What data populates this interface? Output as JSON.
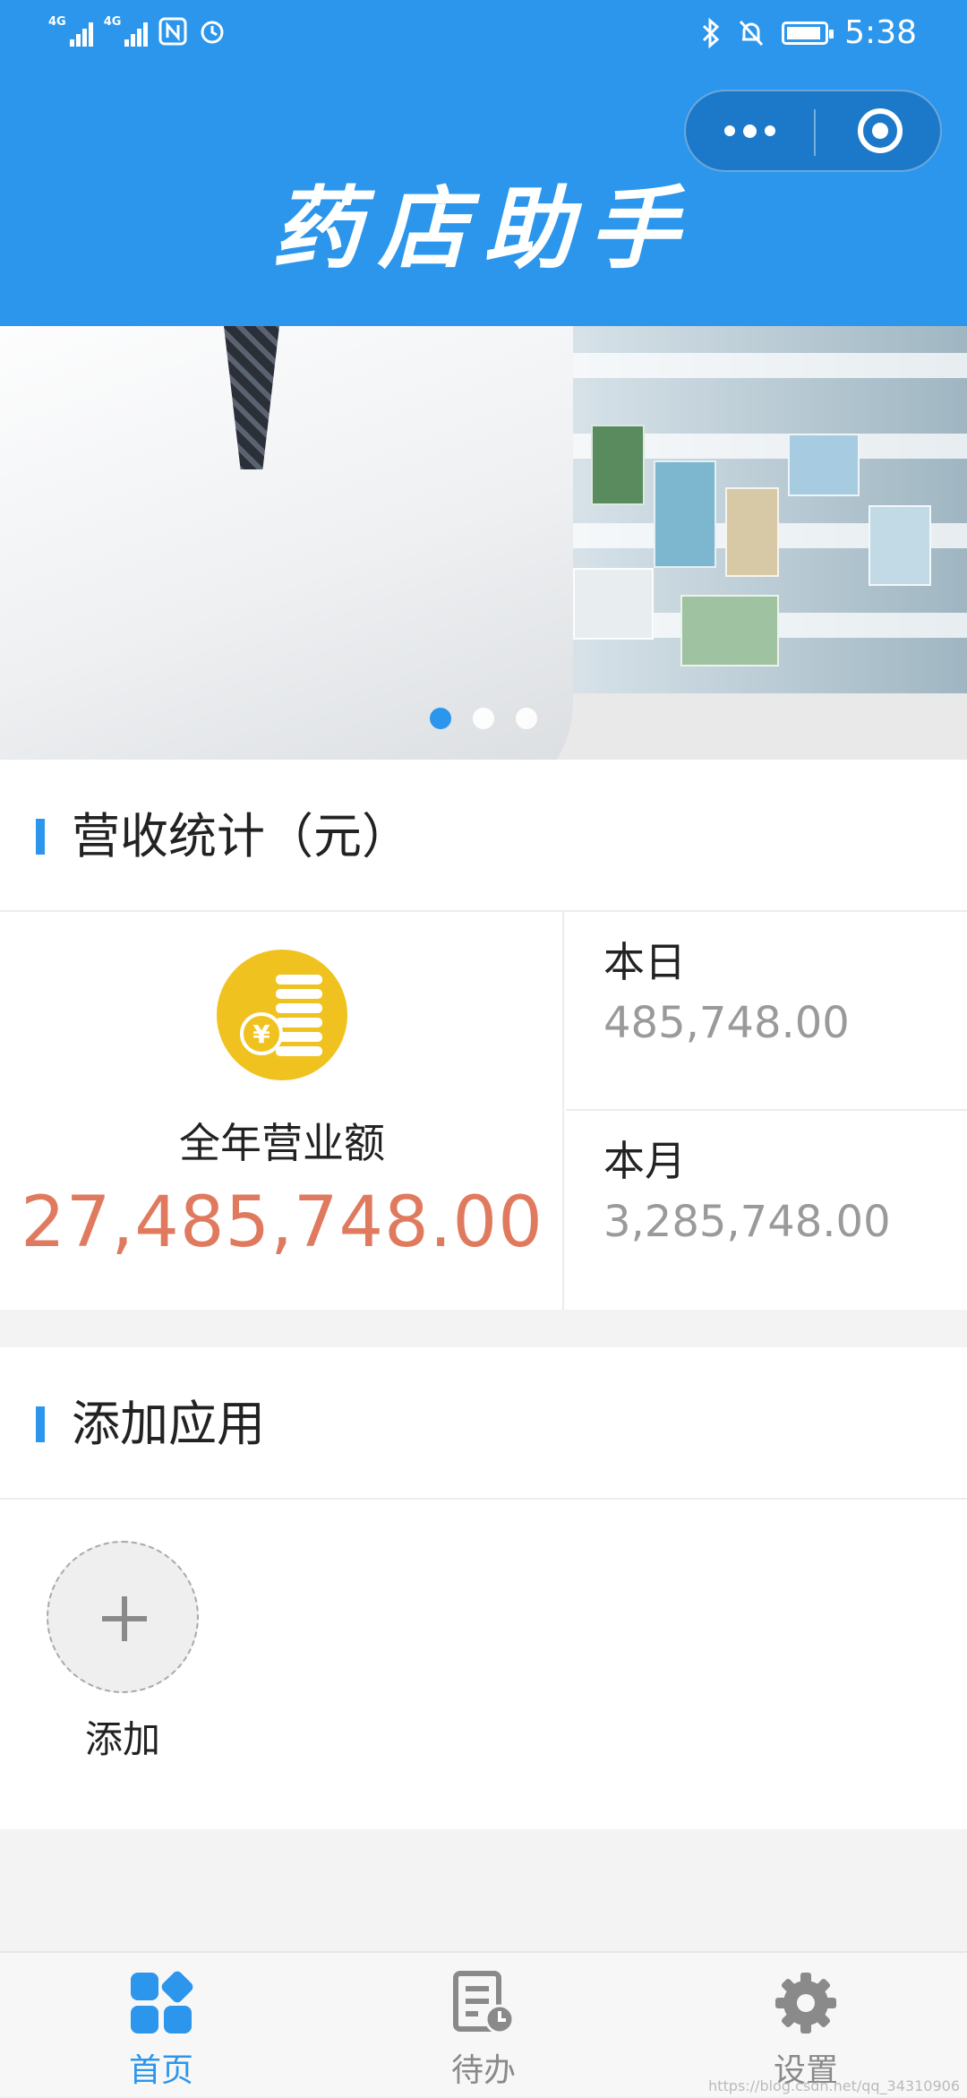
{
  "status_bar": {
    "network_1": "4G",
    "network_2": "4G",
    "time": "5:38"
  },
  "header": {
    "title": "药店助手",
    "capsule": {
      "more_icon": "more-dots-icon",
      "close_icon": "target-circle-icon"
    },
    "background_color": "#2b96ec"
  },
  "banner": {
    "slide_count": 3,
    "active_index": 0
  },
  "revenue": {
    "section_title": "营收统计（元）",
    "total": {
      "label": "全年营业额",
      "value": "27,485,748.00",
      "icon": "coin-stack-icon",
      "color": "#e07a5f"
    },
    "today": {
      "label": "本日",
      "value": "485,748.00"
    },
    "month": {
      "label": "本月",
      "value": "3,285,748.00"
    }
  },
  "apps": {
    "section_title": "添加应用",
    "add": {
      "label": "添加",
      "icon": "plus-icon"
    }
  },
  "tabbar": {
    "tabs": [
      {
        "label": "首页",
        "icon": "home-grid-icon",
        "active": true
      },
      {
        "label": "待办",
        "icon": "todo-list-icon",
        "active": false
      },
      {
        "label": "设置",
        "icon": "gear-icon",
        "active": false
      }
    ],
    "active_color": "#2b96ec",
    "inactive_color": "#8a8a8a"
  },
  "watermark": "https://blog.csdn.net/qq_34310906"
}
